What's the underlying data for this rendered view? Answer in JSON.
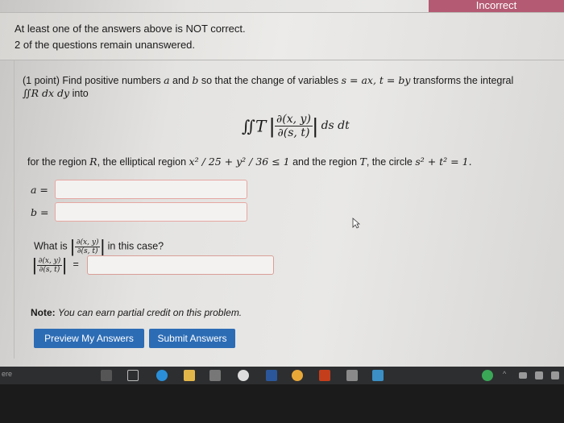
{
  "status_badge": "Incorrect",
  "messages": [
    "At least one of the answers above is NOT correct.",
    "2 of the questions remain unanswered."
  ],
  "problem": {
    "intro": "(1 point) Find positive numbers",
    "var_a": "a",
    "and": "and",
    "var_b": "b",
    "intro_end": "so that the change of variables",
    "transform": "s = ax, t = by",
    "transforms_the_integral": "transforms the integral",
    "integral_R": "∬R dx dy",
    "into": "into",
    "integral_T": "∬T",
    "jacobian_num": "∂(x, y)",
    "jacobian_den": "∂(s, t)",
    "ds_dt": "ds dt",
    "region_text_1": "for the region",
    "R": "R",
    "region_text_2": ", the elliptical region",
    "ellipse": "x² / 25 + y² / 36 ≤ 1",
    "region_text_3": "and the region",
    "T": "T",
    "region_text_4": ", the circle",
    "circle": "s² + t² = 1.",
    "a_label": "a =",
    "b_label": "b =",
    "what_is": "What is",
    "in_this_case": "in this case?",
    "equals": "=",
    "note_label": "Note:",
    "note_text": "You can earn partial credit on this problem."
  },
  "inputs": {
    "a_value": "",
    "b_value": "",
    "jacobian_value": ""
  },
  "buttons": {
    "preview": "Preview My Answers",
    "submit": "Submit Answers"
  },
  "taskbar": {
    "left_text": "ere"
  },
  "colors": {
    "badge": "#b45a72",
    "button": "#2c6cb5",
    "input_error_border": "#e6a7a2"
  }
}
